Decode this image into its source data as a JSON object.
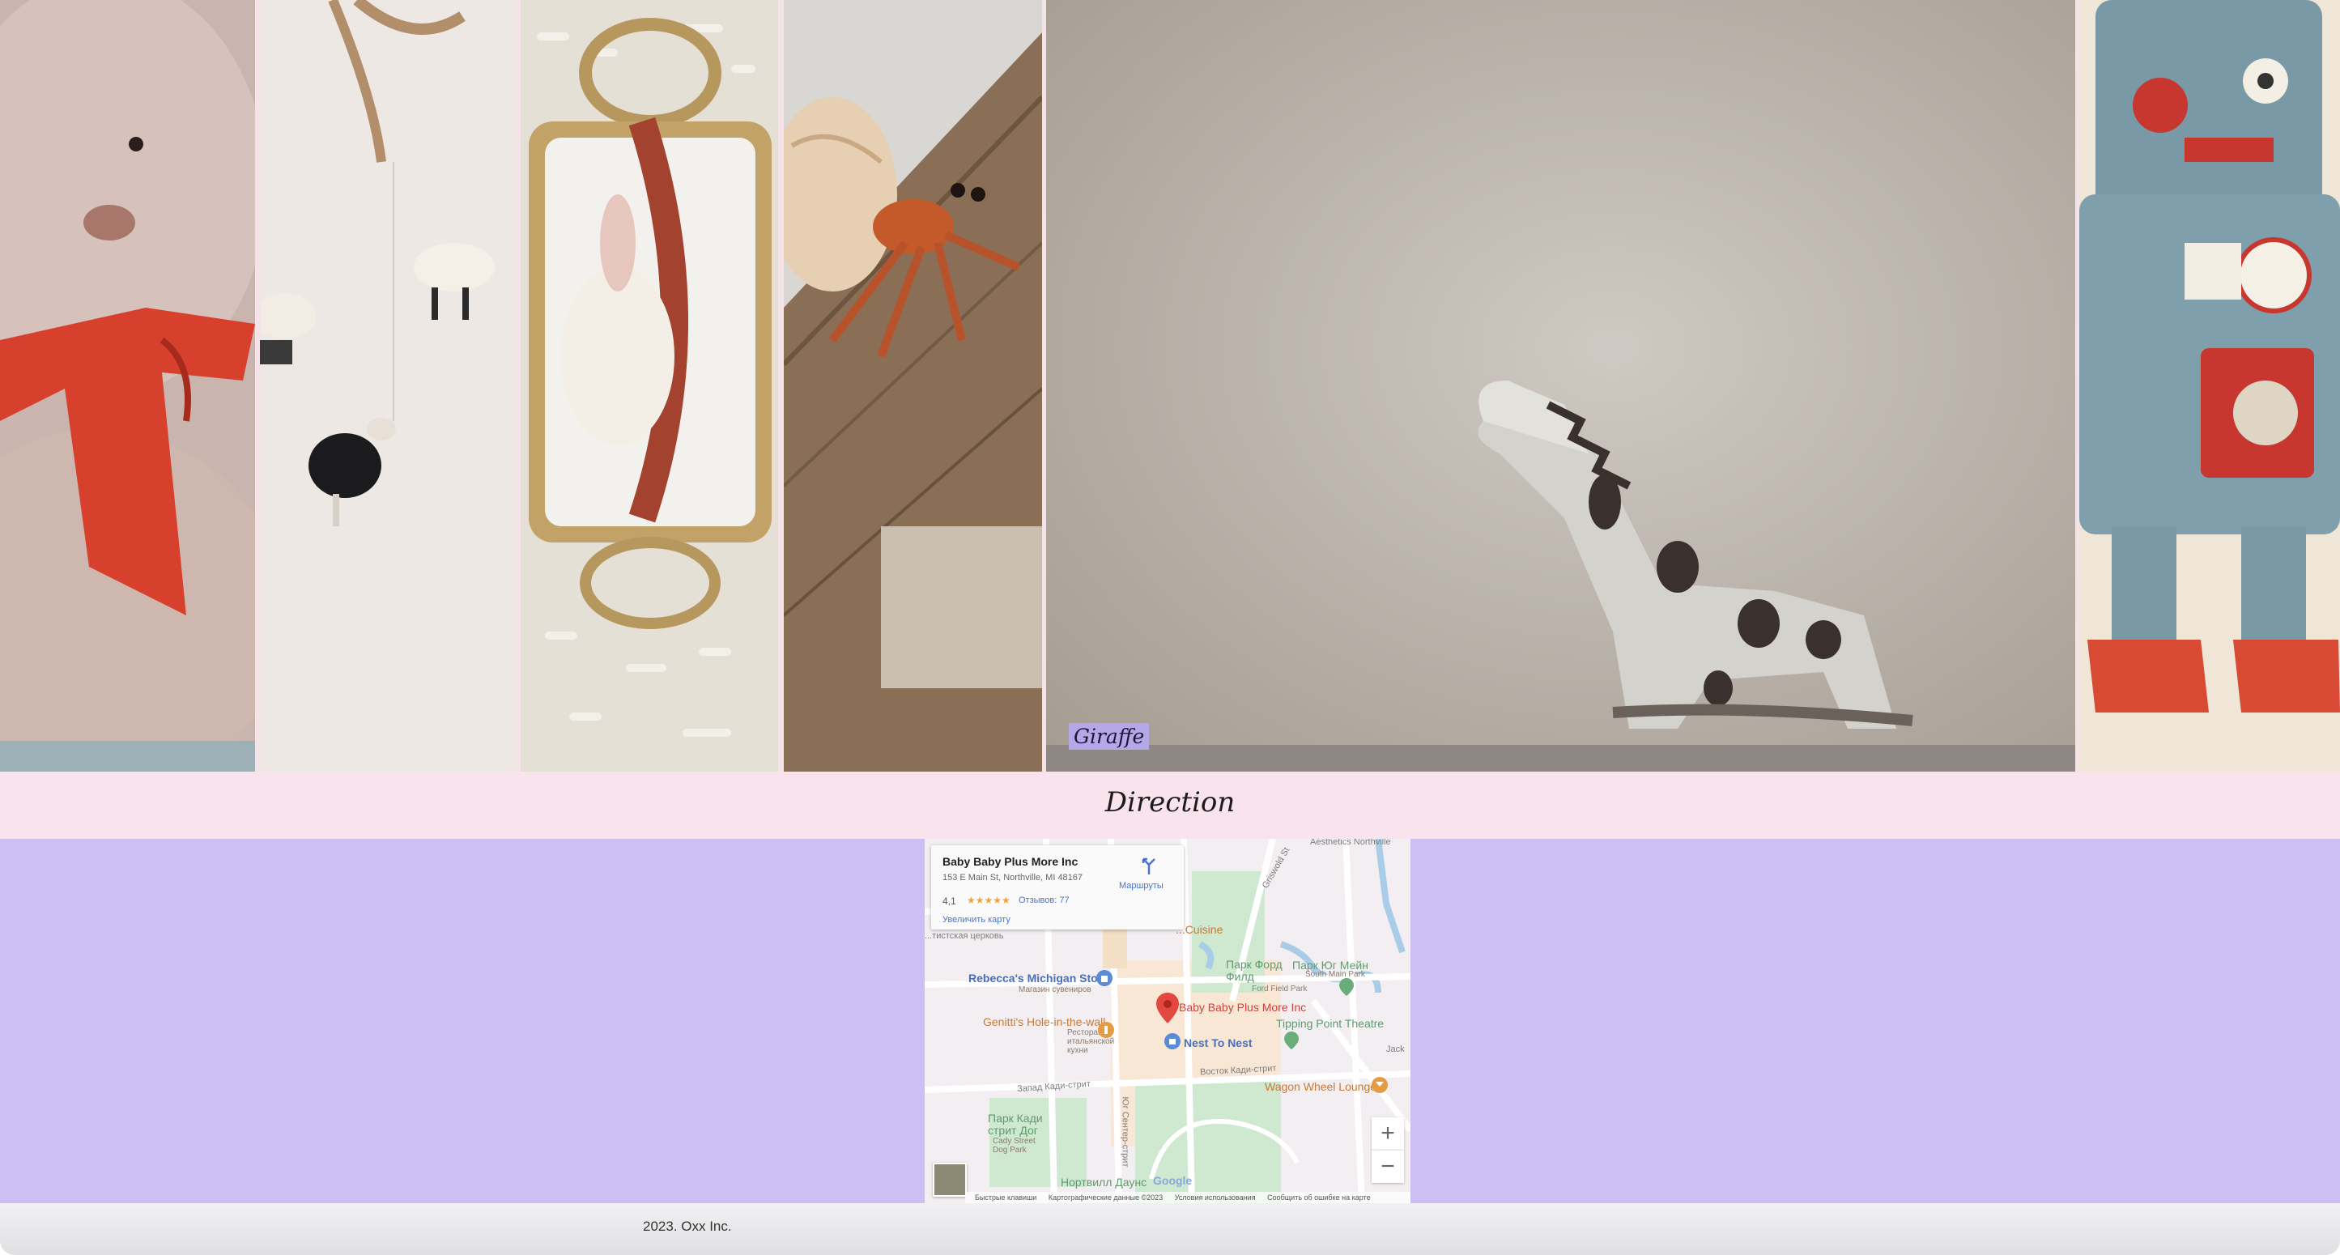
{
  "gallery": {
    "caption": "Giraffe"
  },
  "direction": {
    "title": "Direction"
  },
  "map": {
    "place_name": "Baby Baby Plus More Inc",
    "address": "153 E Main St, Northville, MI 48167",
    "rating": "4,1",
    "stars": "★★★★★",
    "reviews": "Отзывов: 77",
    "enlarge": "Увеличить карту",
    "routes": "Маршруты",
    "labels": {
      "rebeccas": "Rebecca's Michigan Store",
      "rebeccas_sub": "Магазин сувениров",
      "genittis": "Genitti's Hole-in-the-wall",
      "genittis_sub": "Ресторан итальянской кухни",
      "baby_pin": "Baby Baby Plus More Inc",
      "nest": "Nest To Nest",
      "tipping": "Tipping Point Theatre",
      "ford_park": "Парк Форд Филд",
      "ford_park_sub": "Ford Field Park",
      "south_park": "Парк Юг Мейн",
      "south_park_sub": "South Main Park",
      "wagon": "Wagon Wheel Lounge",
      "cady_park": "Парк Кади стрит Дог",
      "cady_park_sub": "Cady Street Dog Park",
      "downs": "Нортвилл Даунс",
      "cady_street_w": "Запад Кади-стрит",
      "cady_street_e": "Восток Кади-стрит",
      "center_street": "Юг Сентер-стрит",
      "griswold": "Griswold St",
      "aesthetics": "Aesthetics Northville",
      "church": "...тистская церковь",
      "cuisine": "...Cuisine",
      "jack": "Jack"
    },
    "zoom_in": "+",
    "zoom_out": "−",
    "google": "Google",
    "attribution": {
      "shortcuts": "Быстрые клавиши",
      "map_data": "Картографические данные ©2023",
      "terms": "Условия использования",
      "report": "Сообщить об ошибке на карте"
    }
  },
  "footer": {
    "text": "2023. Oxx Inc."
  }
}
